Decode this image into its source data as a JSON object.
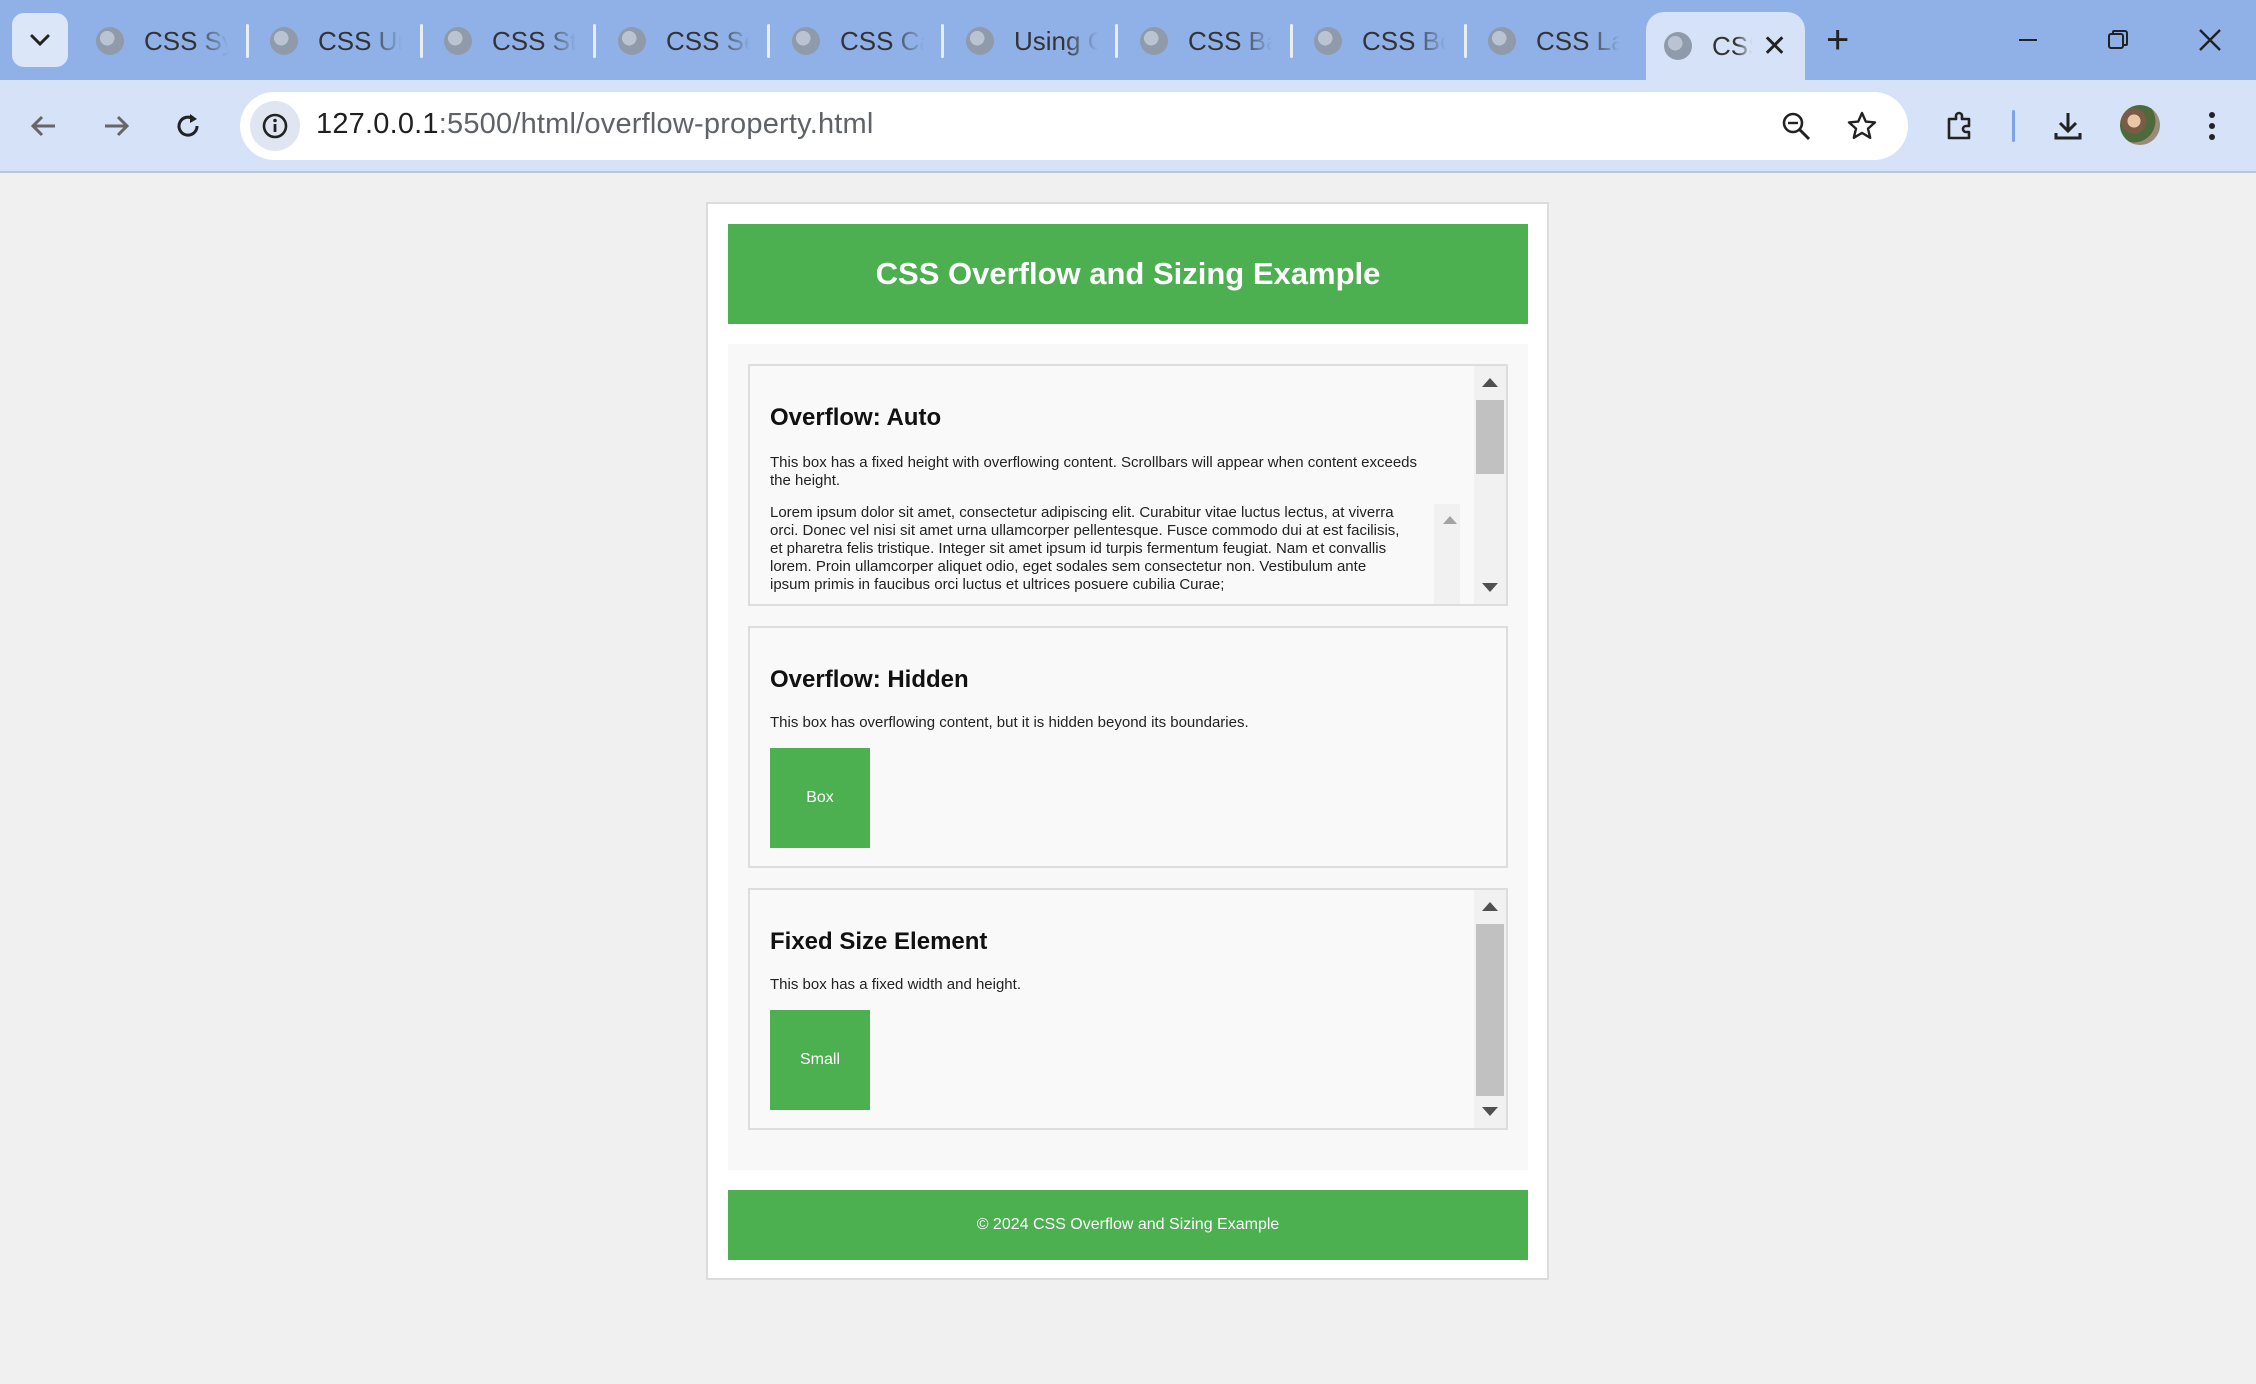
{
  "browser": {
    "tabs": [
      {
        "label": "CSS Syntax"
      },
      {
        "label": "CSS Units"
      },
      {
        "label": "CSS Styles"
      },
      {
        "label": "CSS Selectors"
      },
      {
        "label": "CSS Cascade"
      },
      {
        "label": "Using CSS"
      },
      {
        "label": "CSS Backgrounds"
      },
      {
        "label": "CSS Borders"
      },
      {
        "label": "CSS Layout"
      }
    ],
    "active_tab": {
      "label": "CSS Overflow",
      "close_glyph": "✕"
    },
    "new_tab_glyph": "+",
    "url_host": "127.0.0.1",
    "url_rest": ":5500/html/overflow-property.html",
    "icons": [
      "tab-search-icon",
      "minimize-icon",
      "restore-icon",
      "close-window-icon",
      "back-icon",
      "forward-icon",
      "reload-icon",
      "site-info-icon",
      "zoom-icon",
      "bookmark-star-icon",
      "extensions-icon",
      "download-icon",
      "profile-avatar",
      "menu-icon"
    ]
  },
  "page": {
    "header": "CSS Overflow and Sizing Example",
    "sections": {
      "auto": {
        "title": "Overflow: Auto",
        "description": "This box has a fixed height with overflowing content. Scrollbars will appear when content exceeds the height.",
        "lorem": "Lorem ipsum dolor sit amet, consectetur adipiscing elit. Curabitur vitae luctus lectus, at viverra orci. Donec vel nisi sit amet urna ullamcorper pellentesque. Fusce commodo dui at est facilisis, et pharetra felis tristique. Integer sit amet ipsum id turpis fermentum feugiat. Nam et convallis lorem. Proin ullamcorper aliquet odio, eget sodales sem consectetur non. Vestibulum ante ipsum primis in faucibus orci luctus et ultrices posuere cubilia Curae;"
      },
      "hidden": {
        "title": "Overflow: Hidden",
        "description": "This box has overflowing content, but it is hidden beyond its boundaries.",
        "box_label": "Box"
      },
      "fixed": {
        "title": "Fixed Size Element",
        "description": "This box has a fixed width and height.",
        "box_label": "Small"
      }
    },
    "footer": "© 2024 CSS Overflow and Sizing Example",
    "colors": {
      "accent": "#4caf50",
      "page_bg": "#f0f0f0",
      "box_bg": "#f9f9f9"
    }
  }
}
